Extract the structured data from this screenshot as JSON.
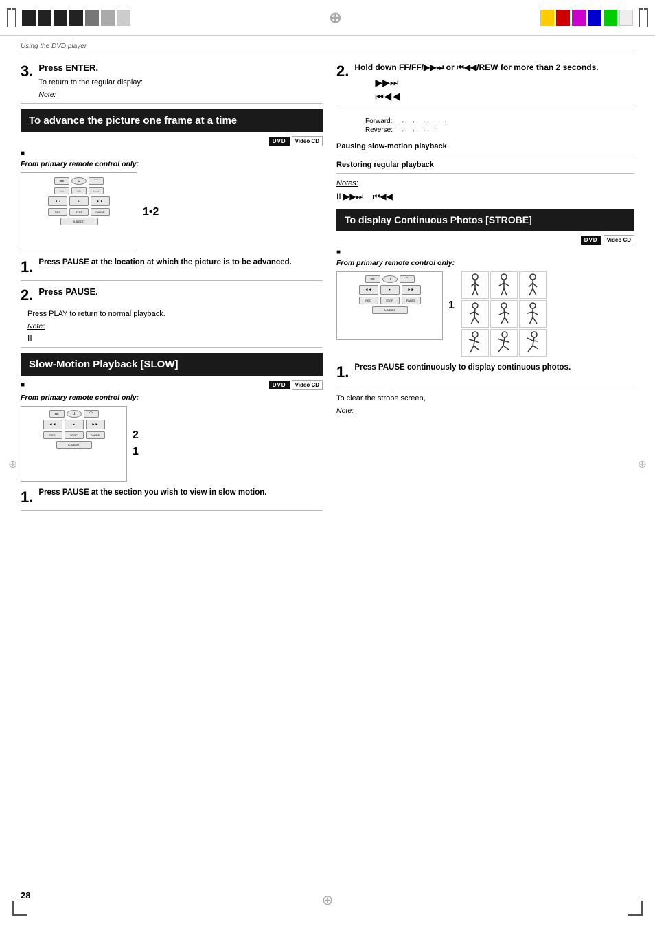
{
  "page": {
    "title": "Using the DVD player",
    "page_number": "28",
    "top_bar_blocks": [
      "dark",
      "dark",
      "dark",
      "dark",
      "light",
      "light",
      "lighter",
      "lighter"
    ],
    "color_blocks": [
      "#ffcc00",
      "#cc0000",
      "#cc00cc",
      "#0000cc",
      "#00cc00",
      "#ffffff"
    ]
  },
  "left_column": {
    "step3": {
      "number": "3.",
      "instruction": "Press ENTER.",
      "sub_note": "To return to the regular display:",
      "note_label": "Note:"
    },
    "section1": {
      "title": "To advance the picture one frame at a time",
      "bullet": "■",
      "from_label": "From primary remote control only:",
      "remote_label": "1•2"
    },
    "step1_advance": {
      "number": "1.",
      "instruction": "Press PAUSE at the location at which the picture is to be advanced."
    },
    "step2_advance": {
      "number": "2.",
      "instruction": "Press PAUSE."
    },
    "play_note": "Press PLAY to return to normal playback.",
    "note2_label": "Note:",
    "note2_symbol": "II",
    "section2": {
      "title": "Slow-Motion Playback [SLOW]",
      "bullet": "■",
      "from_label": "From primary remote control only:",
      "remote_label_2": "2",
      "remote_label_1": "1"
    },
    "step1_slow": {
      "number": "1.",
      "instruction": "Press PAUSE at the section you wish to view in slow motion."
    }
  },
  "right_column": {
    "step2": {
      "number": "2.",
      "instruction": "Hold down FF/",
      "instruction2": " or ",
      "instruction3": "/REW for more than 2 seconds.",
      "symbol1": "▶▶⏭",
      "symbol2": "⏮◀◀"
    },
    "arrow_diagram": {
      "forward_label": "Forward:",
      "forward_arrows": "→  →  →  →  →",
      "reverse_label": "Reverse:",
      "reverse_arrows": "→  →  →  →"
    },
    "pausing_label": "Pausing slow-motion playback",
    "restoring_label": "Restoring regular playback",
    "notes_label": "Notes:",
    "notes_symbols": "II  ▶▶⏭     ⏮◀◀",
    "section3": {
      "title": "To display Continuous Photos [STROBE]",
      "bullet": "■",
      "from_label": "From primary remote control only:",
      "remote_label": "1"
    },
    "step1_strobe": {
      "number": "1.",
      "instruction": "Press PAUSE continuously to display continuous photos."
    },
    "clear_label": "To clear the strobe screen,",
    "note3_label": "Note:"
  },
  "strobe_figures": [
    "🏃",
    "🏃",
    "🏃",
    "🏃",
    "🏃",
    "🏃",
    "🏃",
    "🏃",
    "🏃"
  ]
}
